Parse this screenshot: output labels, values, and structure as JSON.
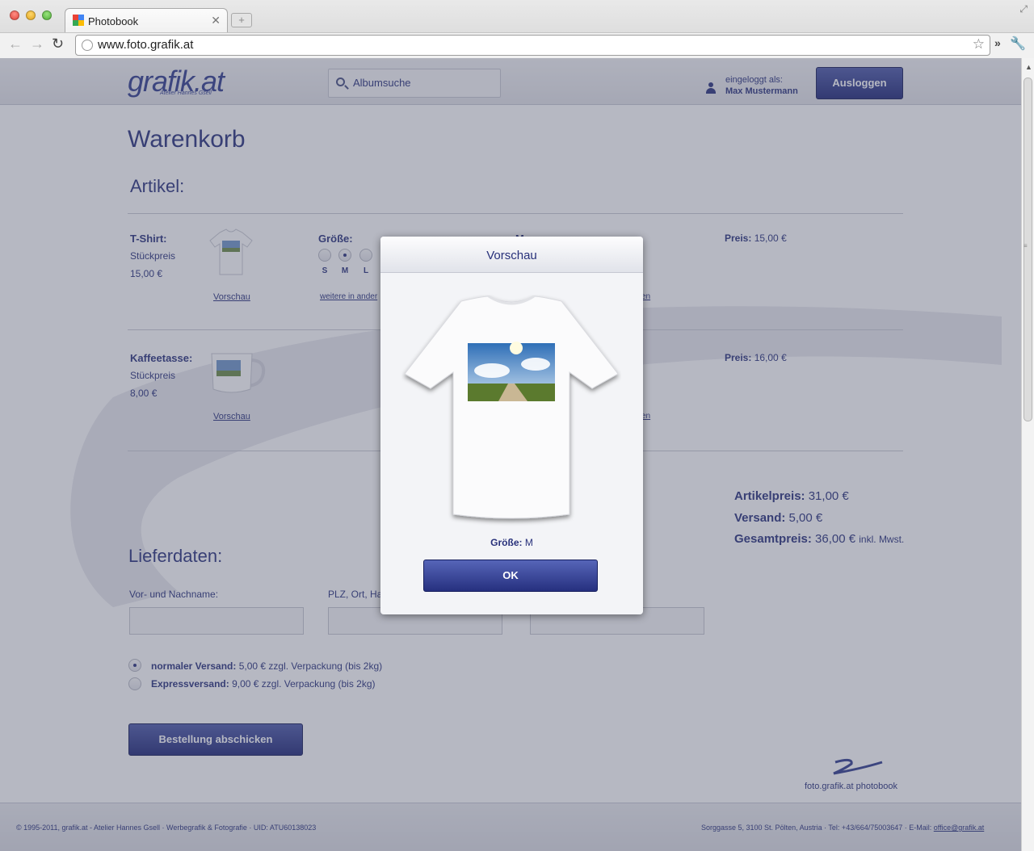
{
  "browser": {
    "tab_title": "Photobook",
    "url": "www.foto.grafik.at"
  },
  "header": {
    "logo": "grafik.at",
    "logo_sub": "Atelier Hannes Gsell",
    "search_placeholder": "Albumsuche",
    "logged_in_label": "eingeloggt als:",
    "user_name": "Max Mustermann",
    "logout_label": "Ausloggen"
  },
  "cart": {
    "title": "Warenkorb",
    "articles_heading": "Artikel:",
    "items": [
      {
        "name": "T-Shirt:",
        "unit_label": "Stückpreis",
        "unit_price": "15,00 €",
        "preview_link": "Vorschau",
        "size_label": "Größe:",
        "sizes": [
          "S",
          "M",
          "L"
        ],
        "selected_size": "M",
        "more_sizes_link": "weitere in ander",
        "price_label": "Preis:",
        "price": "15,00 €",
        "cut_left": "Menge:",
        "cut_link": "en"
      },
      {
        "name": "Kaffeetasse:",
        "unit_label": "Stückpreis",
        "unit_price": "8,00 €",
        "preview_link": "Vorschau",
        "price_label": "Preis:",
        "price": "16,00 €",
        "cut_link": "en"
      }
    ],
    "summary": {
      "item_price_label": "Artikelpreis:",
      "item_price": "31,00 €",
      "shipping_label": "Versand:",
      "shipping": "5,00 €",
      "total_label": "Gesamtpreis:",
      "total": "36,00 €",
      "total_suffix": "inkl. Mwst."
    }
  },
  "delivery": {
    "heading": "Lieferdaten:",
    "name_label": "Vor- und Nachname:",
    "zip_label": "PLZ, Ort, Ha",
    "shipping_options": [
      {
        "label": "normaler Versand:",
        "detail": "5,00 € zzgl. Verpackung (bis 2kg)",
        "selected": true
      },
      {
        "label": "Expressversand:",
        "detail": "9,00 € zzgl. Verpackung (bis 2kg)",
        "selected": false
      }
    ],
    "submit_label": "Bestellung abschicken"
  },
  "footer": {
    "logo_text": "foto.grafik.at photobook",
    "left": "© 1995-2011, grafik.at - Atelier Hannes Gsell · Werbegrafik & Fotografie · UID: ATU60138023",
    "right": "Sorggasse 5, 3100 St. Pölten, Austria · Tel: +43/664/75003647 · E-Mail: ",
    "email": "office@grafik.at"
  },
  "modal": {
    "title": "Vorschau",
    "size_label": "Größe:",
    "size_value": "M",
    "ok_label": "OK"
  },
  "colors": {
    "brand_navy": "#27307a",
    "button_gradient_top": "#4b58a8",
    "button_gradient_bottom": "#1d2676"
  }
}
